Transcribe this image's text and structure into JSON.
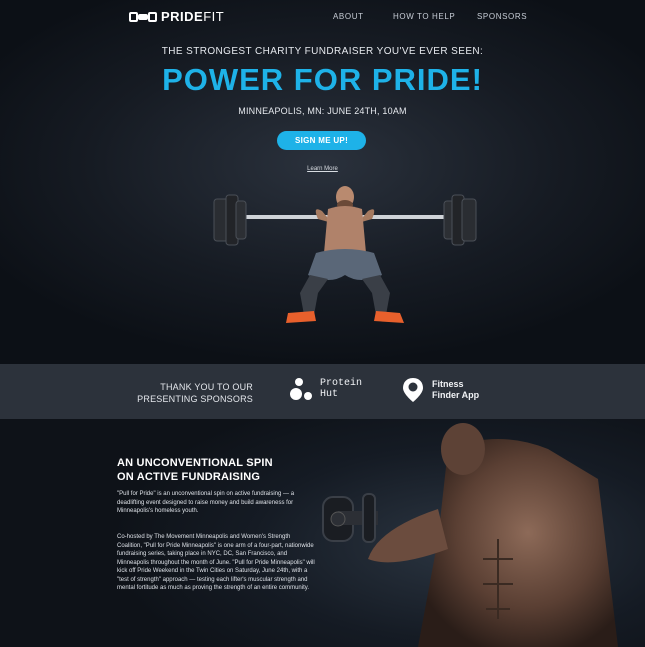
{
  "nav": {
    "logo_bold": "PRIDE",
    "logo_light": "FIT",
    "links": [
      "ABOUT",
      "HOW TO HELP",
      "SPONSORS"
    ]
  },
  "hero": {
    "pre_title": "THE STRONGEST CHARITY FUNDRAISER YOU'VE EVER SEEN:",
    "title": "POWER FOR PRIDE!",
    "event_info": "MINNEAPOLIS, MN: JUNE 24TH, 10AM",
    "cta_label": "SIGN ME UP!",
    "learn_more": "Learn More"
  },
  "sponsors": {
    "thanks_line1": "THANK YOU TO OUR",
    "thanks_line2": "PRESENTING SPONSORS",
    "items": [
      {
        "line1": "Protein",
        "line2": "Hut",
        "icon": "protein-hut-logo-icon"
      },
      {
        "line1": "Fitness",
        "line2": "Finder App",
        "icon": "map-pin-logo-icon"
      }
    ]
  },
  "about": {
    "title_line1": "AN UNCONVENTIONAL SPIN",
    "title_line2": "ON ACTIVE FUNDRAISING",
    "paragraph1": "\"Pull for Pride\" is an unconventional spin on active fundraising — a deadlifting event designed to raise money and build awareness for Minneapolis's homeless youth.",
    "paragraph2": "Co-hosted by The Movement Minneapolis and Women's Strength Coalition, \"Pull for Pride Minneapolis\" is one arm of a four-part, nationwide fundraising series, taking place in NYC, DC, San Francisco, and Minneapolis throughout the month of June. \"Pull for Pride Minneapolis\" will kick off Pride Weekend in the Twin Cities on Saturday, June 24th, with a \"test of strength\" approach — testing each lifter's muscular strength and mental fortitude as much as proving the strength of an entire community."
  },
  "colors": {
    "accent": "#1eb2e8",
    "sponsor_bar": "#2c323b",
    "background": "#0f141c"
  }
}
